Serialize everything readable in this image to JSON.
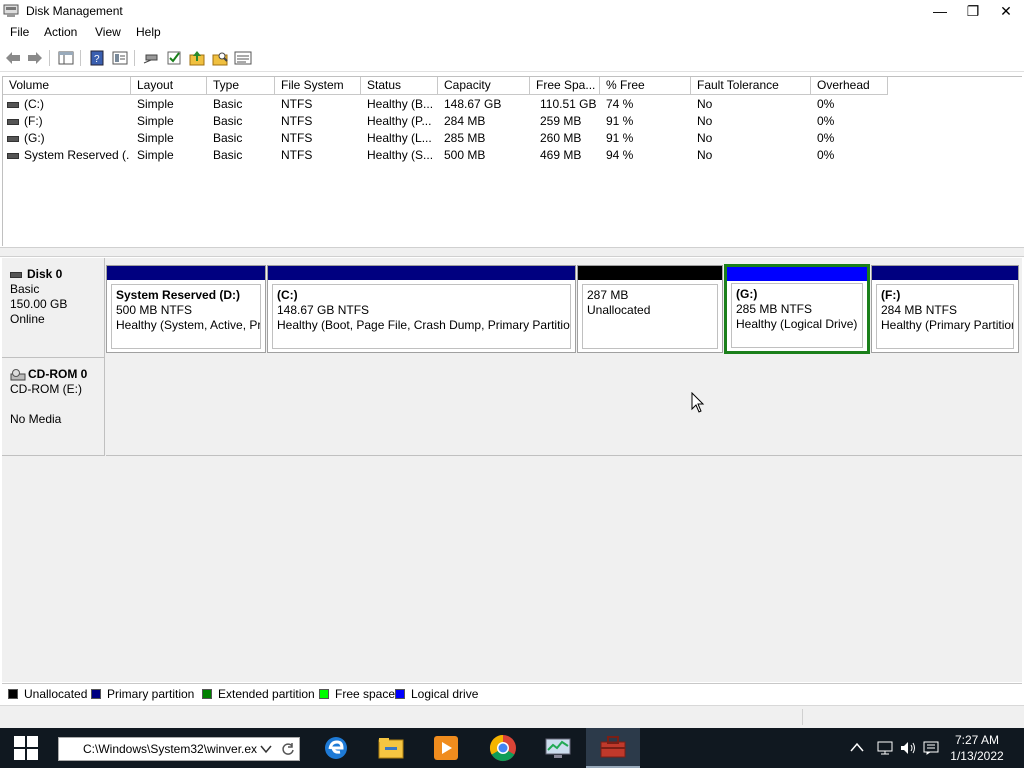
{
  "window": {
    "title": "Disk Management",
    "minimize": "—",
    "restore": "❐",
    "close": "✕"
  },
  "menu": [
    "File",
    "Action",
    "View",
    "Help"
  ],
  "toolbar": {
    "icons": [
      "back-arrow-icon",
      "forward-arrow-icon",
      "console-tree-icon",
      "help-icon",
      "properties-icon",
      "disk-connect-icon",
      "checkmark-icon",
      "folder-up-icon",
      "folder-search-icon",
      "list-view-icon"
    ]
  },
  "volume_table": {
    "columns": [
      "Volume",
      "Layout",
      "Type",
      "File System",
      "Status",
      "Capacity",
      "Free Spa...",
      "% Free",
      "Fault Tolerance",
      "Overhead"
    ],
    "rows": [
      [
        "(C:)",
        "Simple",
        "Basic",
        "NTFS",
        "Healthy (B...",
        "148.67 GB",
        "110.51 GB",
        "74 %",
        "No",
        "0%"
      ],
      [
        "(F:)",
        "Simple",
        "Basic",
        "NTFS",
        "Healthy (P...",
        "284 MB",
        "259 MB",
        "91 %",
        "No",
        "0%"
      ],
      [
        "(G:)",
        "Simple",
        "Basic",
        "NTFS",
        "Healthy (L...",
        "285 MB",
        "260 MB",
        "91 %",
        "No",
        "0%"
      ],
      [
        "System Reserved (...",
        "Simple",
        "Basic",
        "NTFS",
        "Healthy (S...",
        "500 MB",
        "469 MB",
        "94 %",
        "No",
        "0%"
      ]
    ]
  },
  "disk0": {
    "name": "Disk 0",
    "type": "Basic",
    "size": "150.00 GB",
    "state": "Online",
    "partitions": [
      {
        "name": "System Reserved  (D:)",
        "size": "500 MB NTFS",
        "status": "Healthy (System, Active, Pri",
        "color": "#000080"
      },
      {
        "name": "(C:)",
        "size": "148.67 GB NTFS",
        "status": "Healthy (Boot, Page File, Crash Dump, Primary Partition",
        "color": "#000080"
      },
      {
        "name": "",
        "size": "287 MB",
        "status": "Unallocated",
        "color": "#000000"
      },
      {
        "name": "(G:)",
        "size": "285 MB NTFS",
        "status": "Healthy (Logical Drive)",
        "color": "#0000ff"
      },
      {
        "name": "(F:)",
        "size": "284 MB NTFS",
        "status": "Healthy (Primary Partition",
        "color": "#000080"
      }
    ]
  },
  "cdrom0": {
    "name": "CD-ROM 0",
    "type": "CD-ROM (E:)",
    "state": "No Media"
  },
  "legend": [
    {
      "label": "Unallocated",
      "color": "#000000"
    },
    {
      "label": "Primary partition",
      "color": "#000080"
    },
    {
      "label": "Extended partition",
      "color": "#008000"
    },
    {
      "label": "Free space",
      "color": "#00ff00"
    },
    {
      "label": "Logical drive",
      "color": "#0000ff"
    }
  ],
  "taskbar": {
    "search_text": "C:\\Windows\\System32\\winver.ex",
    "apps": [
      "edge-icon",
      "file-explorer-icon",
      "media-player-icon",
      "chrome-icon",
      "performance-monitor-icon",
      "computer-management-icon"
    ],
    "time": "7:27 AM",
    "date": "1/13/2022"
  }
}
